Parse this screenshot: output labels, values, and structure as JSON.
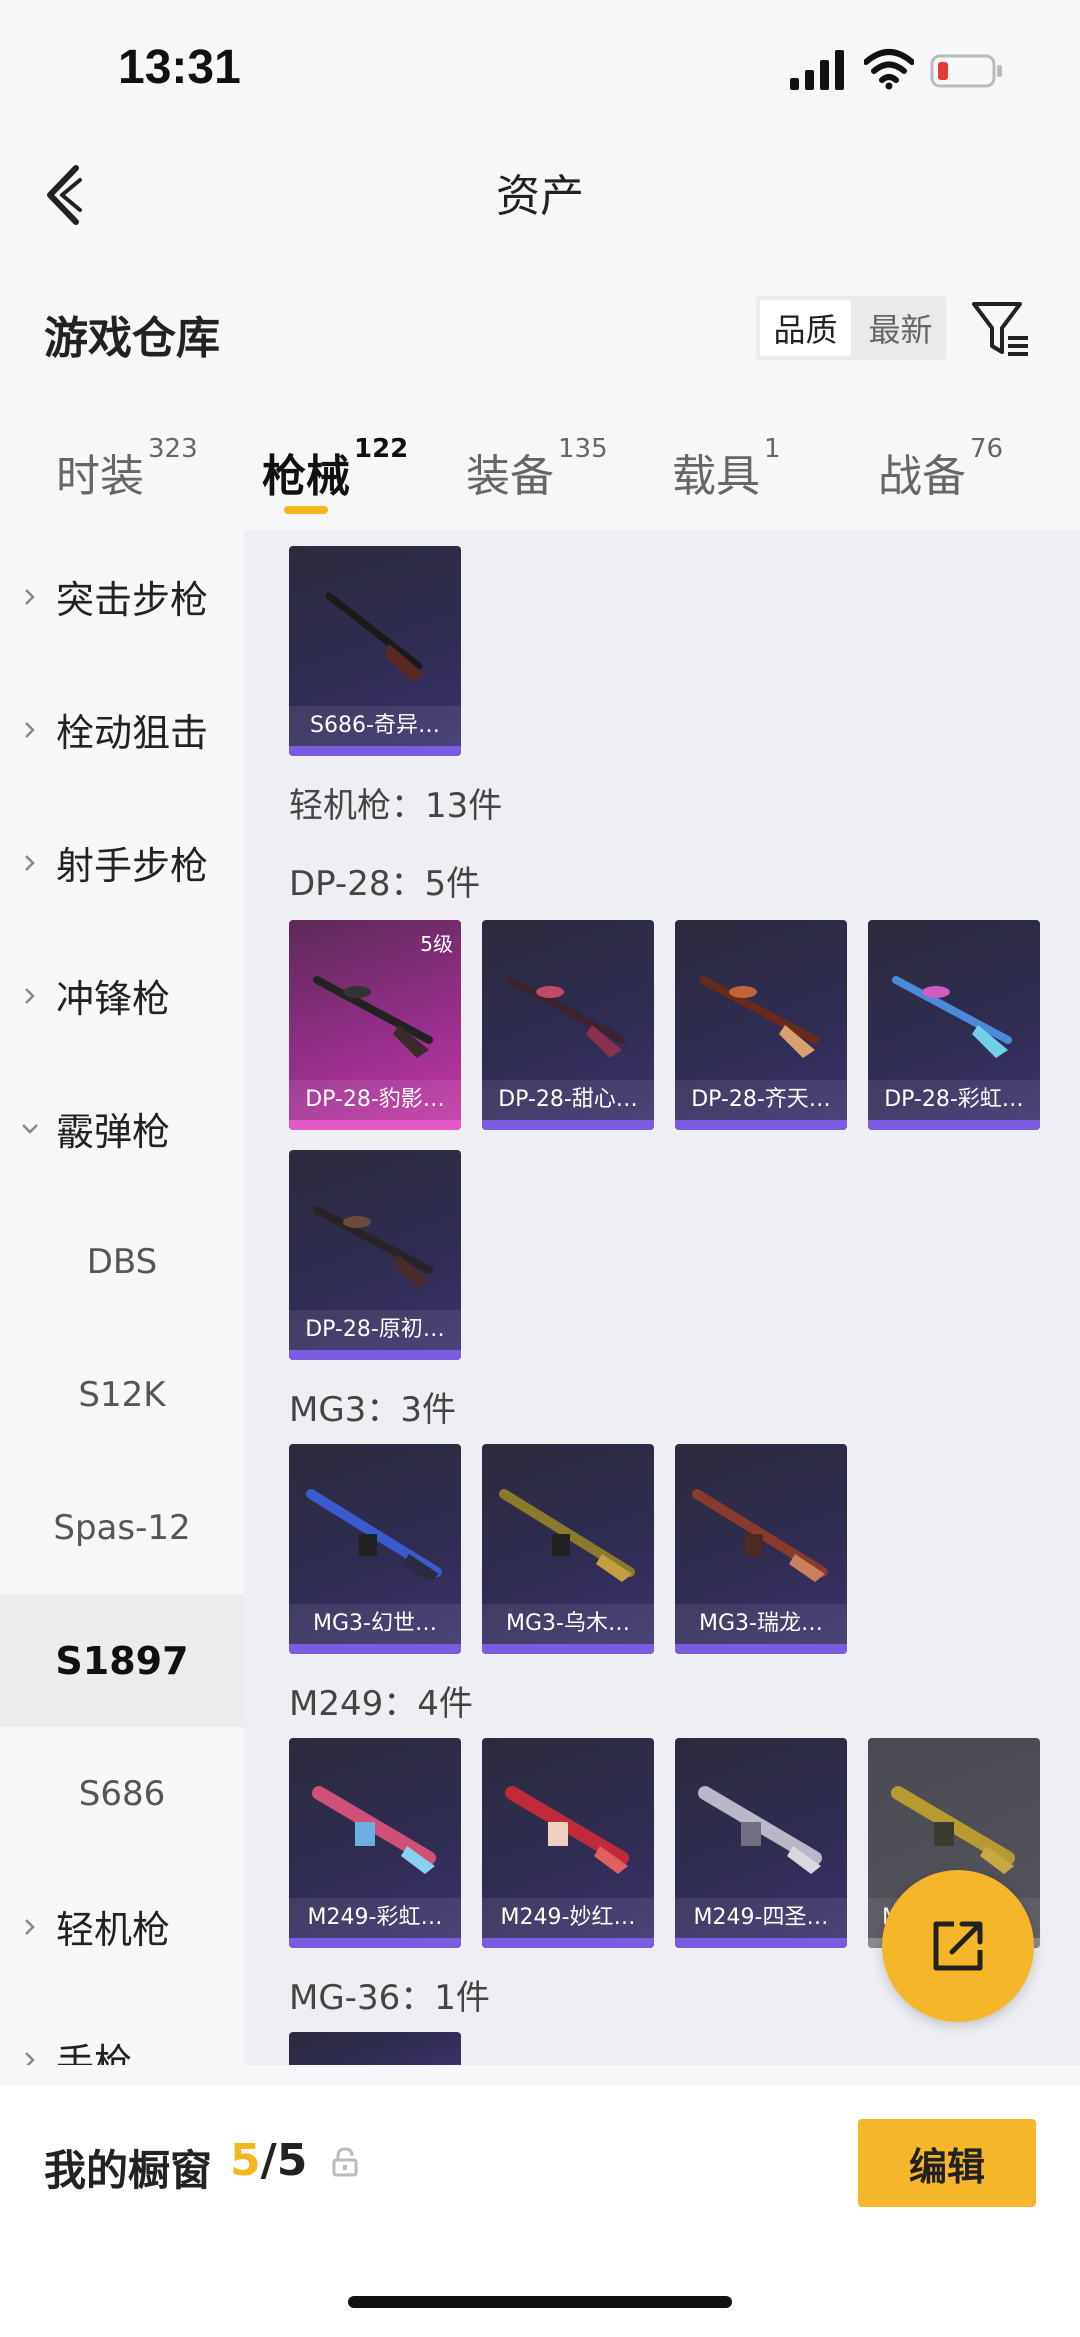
{
  "status": {
    "time": "13:31"
  },
  "nav": {
    "title": "资产"
  },
  "repo": {
    "title": "游戏仓库",
    "sort_options": [
      "品质",
      "最新"
    ]
  },
  "tabs": [
    {
      "label": "时装",
      "count": "323"
    },
    {
      "label": "枪械",
      "count": "122"
    },
    {
      "label": "装备",
      "count": "135"
    },
    {
      "label": "载具",
      "count": "1"
    },
    {
      "label": "战备",
      "count": "76"
    }
  ],
  "sidebar": {
    "items": [
      {
        "label": "突击步枪",
        "type": "category"
      },
      {
        "label": "栓动狙击",
        "type": "category"
      },
      {
        "label": "射手步枪",
        "type": "category"
      },
      {
        "label": "冲锋枪",
        "type": "category"
      },
      {
        "label": "霰弹枪",
        "type": "category-open"
      },
      {
        "label": "DBS",
        "type": "sub"
      },
      {
        "label": "S12K",
        "type": "sub"
      },
      {
        "label": "Spas-12",
        "type": "sub"
      },
      {
        "label": "S1897",
        "type": "sub-selected"
      },
      {
        "label": "S686",
        "type": "sub"
      },
      {
        "label": "轻机枪",
        "type": "category"
      },
      {
        "label": "手枪",
        "type": "category"
      }
    ]
  },
  "content": {
    "top_card": {
      "name": "S686-奇异…"
    },
    "lmg_summary": "轻机枪：13件",
    "groups": [
      {
        "title": "DP-28：5件",
        "cards": [
          {
            "name": "DP-28-豹影…",
            "level": "5级",
            "style": "pink"
          },
          {
            "name": "DP-28-甜心…"
          },
          {
            "name": "DP-28-齐天…"
          },
          {
            "name": "DP-28-彩虹…"
          },
          {
            "name": "DP-28-原初…"
          }
        ]
      },
      {
        "title": "MG3：3件",
        "cards": [
          {
            "name": "MG3-幻世…"
          },
          {
            "name": "MG3-乌木…"
          },
          {
            "name": "MG3-瑞龙…"
          }
        ]
      },
      {
        "title": "M249：4件",
        "cards": [
          {
            "name": "M249-彩虹…"
          },
          {
            "name": "M249-妙红…"
          },
          {
            "name": "M249-四圣…"
          },
          {
            "name": "M",
            "style": "grey"
          }
        ]
      },
      {
        "title": "MG-36：1件",
        "cards": []
      }
    ]
  },
  "bottom": {
    "window_label": "我的橱窗",
    "count_current": "5",
    "count_total": "/5",
    "edit_label": "编辑"
  },
  "colors": {
    "accent": "#f6b62a",
    "highlight": "#f5b51f"
  }
}
